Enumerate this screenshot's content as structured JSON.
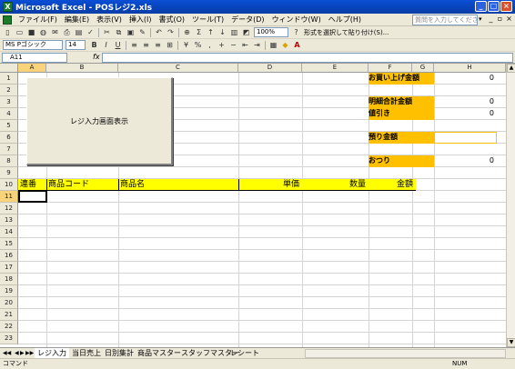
{
  "window": {
    "title": "Microsoft Excel - POSレジ2.xls",
    "app_icon": "X"
  },
  "menu": {
    "items": [
      "ファイル(F)",
      "編集(E)",
      "表示(V)",
      "挿入(I)",
      "書式(O)",
      "ツール(T)",
      "データ(D)",
      "ウィンドウ(W)",
      "ヘルプ(H)"
    ],
    "help_placeholder": "質問を入力してください"
  },
  "toolbar": {
    "zoom": "100%",
    "review_label": "形式を選択して貼り付け(S)..."
  },
  "format_toolbar": {
    "font_name": "MS Pゴシック",
    "font_size": "14"
  },
  "formula_bar": {
    "name_box": "A11",
    "fx": "fx",
    "formula": ""
  },
  "columns": [
    "A",
    "B",
    "C",
    "D",
    "E",
    "F",
    "G",
    "H"
  ],
  "rows": [
    "1",
    "2",
    "3",
    "4",
    "5",
    "6",
    "7",
    "8",
    "9",
    "10",
    "11",
    "12",
    "13",
    "14",
    "15",
    "16",
    "17",
    "18",
    "19",
    "20",
    "21",
    "22",
    "23"
  ],
  "selected_cell": "A11",
  "button": {
    "label": "レジ入力画面表示"
  },
  "summary": {
    "total_label": "お買い上げ金額",
    "total_value": "0",
    "subtotal_label": "明細合計金額",
    "subtotal_value": "0",
    "discount_label": "値引き",
    "discount_value": "0",
    "deposit_label": "預り金額",
    "deposit_value": "",
    "change_label": "おつり",
    "change_value": "0"
  },
  "table_header": {
    "seq": "連番",
    "code": "商品コード",
    "name": "商品名",
    "price": "単価",
    "qty": "数量",
    "amount": "金額"
  },
  "sheets": [
    "レジ入力",
    "当日売上",
    "日別集計",
    "商品マスター",
    "スタッフマスター",
    "レシート"
  ],
  "active_sheet": "レジ入力",
  "status": {
    "mode": "コマンド",
    "numlock": "NUM"
  },
  "colors": {
    "title_bar": "#0a4fd6",
    "header_yellow": "#ffff00",
    "label_orange": "#ffc000",
    "selected_header": "#f8d37a"
  }
}
